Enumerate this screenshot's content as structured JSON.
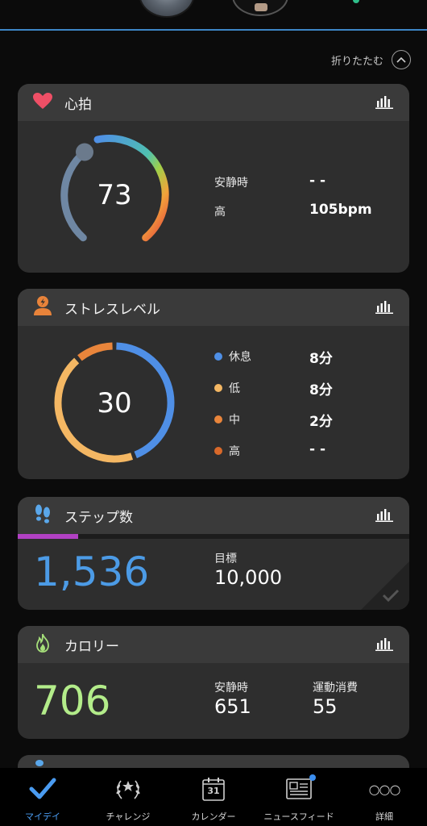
{
  "header": {
    "collapse_label": "折りたたむ"
  },
  "heart": {
    "title": "心拍",
    "current": "73",
    "rows": [
      {
        "label": "安静時",
        "value": "- -"
      },
      {
        "label": "高",
        "value": "105bpm"
      }
    ]
  },
  "stress": {
    "title": "ストレスレベル",
    "current": "30",
    "legend": [
      {
        "label": "休息",
        "value": "8分",
        "color": "#4f8fe6"
      },
      {
        "label": "低",
        "value": "8分",
        "color": "#f4b763"
      },
      {
        "label": "中",
        "value": "2分",
        "color": "#e9853b"
      },
      {
        "label": "高",
        "value": "- -",
        "color": "#d9692a"
      }
    ]
  },
  "steps": {
    "title": "ステップ数",
    "count": "1,536",
    "goal_label": "目標",
    "goal_value": "10,000",
    "progress_fraction": 0.1536
  },
  "calories": {
    "title": "カロリー",
    "total": "706",
    "resting_label": "安静時",
    "resting_value": "651",
    "active_label": "運動消費",
    "active_value": "55"
  },
  "tabs": [
    {
      "label": "マイデイ",
      "icon": "check-icon",
      "active": true
    },
    {
      "label": "チャレンジ",
      "icon": "laurel-icon",
      "active": false
    },
    {
      "label": "カレンダー",
      "icon": "calendar-icon",
      "active": false,
      "icon_text": "31"
    },
    {
      "label": "ニュースフィード",
      "icon": "news-icon",
      "active": false
    },
    {
      "label": "詳細",
      "icon": "more-icon",
      "active": false,
      "icon_text": "○○○"
    }
  ]
}
